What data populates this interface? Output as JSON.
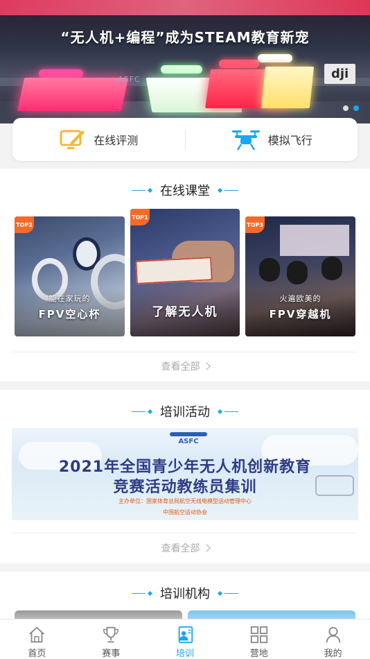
{
  "banner": {
    "title": "“无人机+编程”成为STEAM教育新宠",
    "brand_mark": "dji",
    "sign_text": "ASFC",
    "dots": 2,
    "active_dot": 1
  },
  "quick": {
    "items": [
      {
        "label": "在线评测",
        "icon": "tablet-pen-icon"
      },
      {
        "label": "模拟飞行",
        "icon": "drone-icon"
      }
    ]
  },
  "courses": {
    "title": "在线课堂",
    "see_all": "查看全部",
    "cards": [
      {
        "badge": "TOP2",
        "caption_small": "能在家玩的",
        "caption_big": "FPV空心杯"
      },
      {
        "badge": "TOP1",
        "caption_small": "",
        "caption_big": "了解无人机"
      },
      {
        "badge": "TOP3",
        "caption_small": "火遍欧美的",
        "caption_big": "FPV穿越机"
      }
    ]
  },
  "training": {
    "title": "培训活动",
    "see_all": "查看全部",
    "banner": {
      "logo": "ASFC",
      "line1": "2021年全国青少年无人机创新教育",
      "line2": "竞赛活动教练员集训",
      "org1": "主办单位：国家体育总局航空无线电模型运动管理中心",
      "org2": "中国航空运动协会"
    }
  },
  "institutions": {
    "title": "培训机构"
  },
  "tabbar": {
    "active": "培训",
    "items": [
      {
        "label": "首页",
        "icon": "home-icon"
      },
      {
        "label": "赛事",
        "icon": "trophy-icon"
      },
      {
        "label": "培训",
        "icon": "training-icon"
      },
      {
        "label": "营地",
        "icon": "grid-icon"
      },
      {
        "label": "我的",
        "icon": "user-icon"
      }
    ]
  },
  "colors": {
    "accent": "#19a7f1",
    "badge": "#f46a2b",
    "quick_icon_left": "#f4b73a",
    "quick_icon_right": "#19a7f1"
  }
}
